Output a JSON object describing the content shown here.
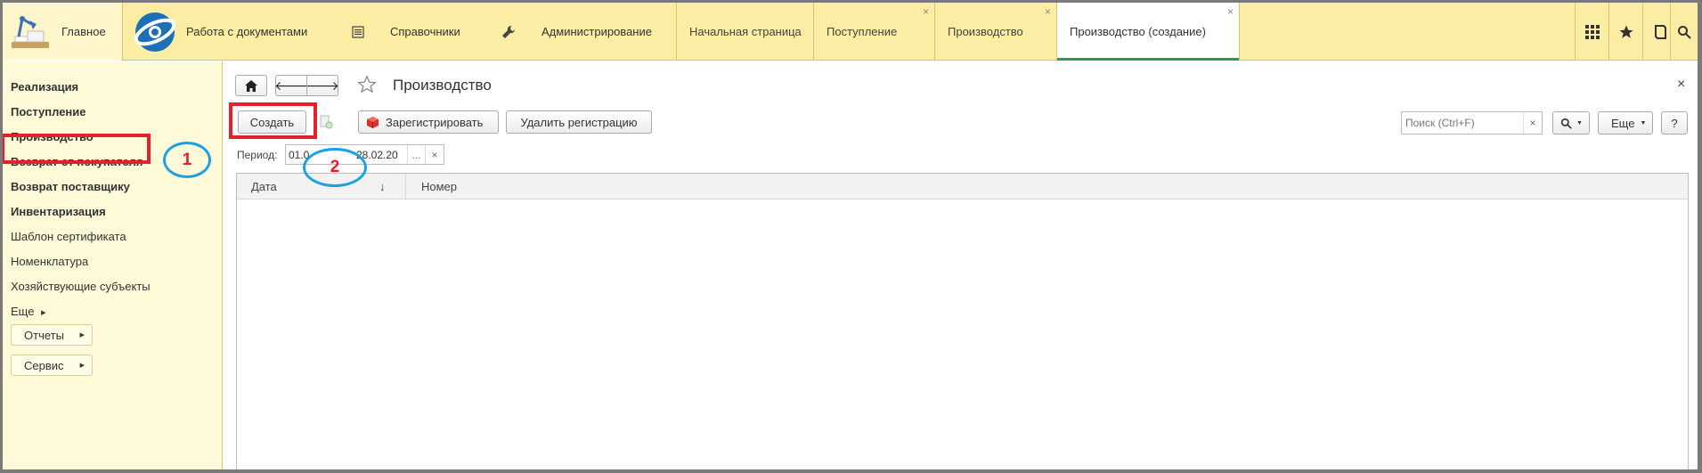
{
  "topbar": {
    "home_label": "Главное",
    "docs_label": "Работа с документами",
    "refs_label": "Справочники",
    "admin_label": "Администрирование",
    "tabs": [
      {
        "label": "Начальная страница"
      },
      {
        "label": "Поступление"
      },
      {
        "label": "Производство"
      },
      {
        "label": "Производство (создание)"
      }
    ],
    "close_glyph": "×"
  },
  "sidebar": {
    "items": [
      {
        "label": "Реализация"
      },
      {
        "label": "Поступление"
      },
      {
        "label": "Производство"
      },
      {
        "label": "Возврат от покупателя"
      },
      {
        "label": "Возврат поставщику"
      },
      {
        "label": "Инвентаризация"
      },
      {
        "label": "Шаблон сертификата"
      },
      {
        "label": "Номенклатура"
      },
      {
        "label": "Хозяйствующие субъекты"
      },
      {
        "label": "Еще"
      }
    ],
    "buttons": [
      {
        "label": "Отчеты"
      },
      {
        "label": "Сервис"
      }
    ]
  },
  "content": {
    "title": "Производство",
    "create_label": "Создать",
    "register_label": "Зарегистрировать",
    "unregister_label": "Удалить регистрацию",
    "search_placeholder": "Поиск (Ctrl+F)",
    "more_label": "Еще",
    "help_label": "?",
    "period_label": "Период:",
    "period_from": "01.0",
    "period_to": "28.02.20",
    "period_select": "...",
    "clear_glyph": "×",
    "columns": [
      {
        "label": "Дата",
        "sort": "↓"
      },
      {
        "label": "Номер"
      }
    ]
  },
  "annotations": {
    "marker1": "1",
    "marker2": "2"
  },
  "colors": {
    "topbar_bg": "#fbeda4",
    "sidebar_bg": "#fffbd8",
    "active_tab_line": "#2e9b4b",
    "annotation_red": "#e4202a",
    "annotation_blue": "#1ea0e0"
  },
  "icons": [
    "home-icon",
    "arrow-left-icon",
    "arrow-right-icon",
    "star-outline-icon",
    "apps-grid-icon",
    "favorites-star-icon",
    "history-icon",
    "search-icon",
    "close-icon"
  ]
}
